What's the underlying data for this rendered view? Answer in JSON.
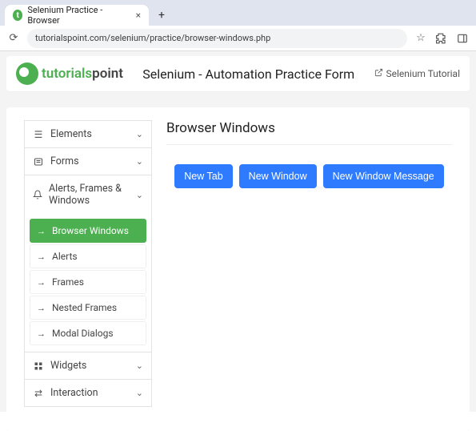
{
  "browser": {
    "tab_title": "Selenium Practice - Browser",
    "url": "tutorialspoint.com/selenium/practice/browser-windows.php"
  },
  "header": {
    "logo_text_a": "tutorials",
    "logo_text_b": "point",
    "title": "Selenium - Automation Practice Form",
    "link_text": "Selenium Tutorial"
  },
  "sidebar": {
    "items": [
      {
        "label": "Elements"
      },
      {
        "label": "Forms"
      },
      {
        "label": "Alerts, Frames & Windows"
      },
      {
        "label": "Widgets"
      },
      {
        "label": "Interaction"
      }
    ],
    "sub": {
      "browser_windows": "Browser Windows",
      "alerts": "Alerts",
      "frames": "Frames",
      "nested_frames": "Nested Frames",
      "modal_dialogs": "Modal Dialogs"
    }
  },
  "main": {
    "title": "Browser Windows",
    "buttons": {
      "new_tab": "New Tab",
      "new_window": "New Window",
      "new_window_message": "New Window Message"
    }
  }
}
